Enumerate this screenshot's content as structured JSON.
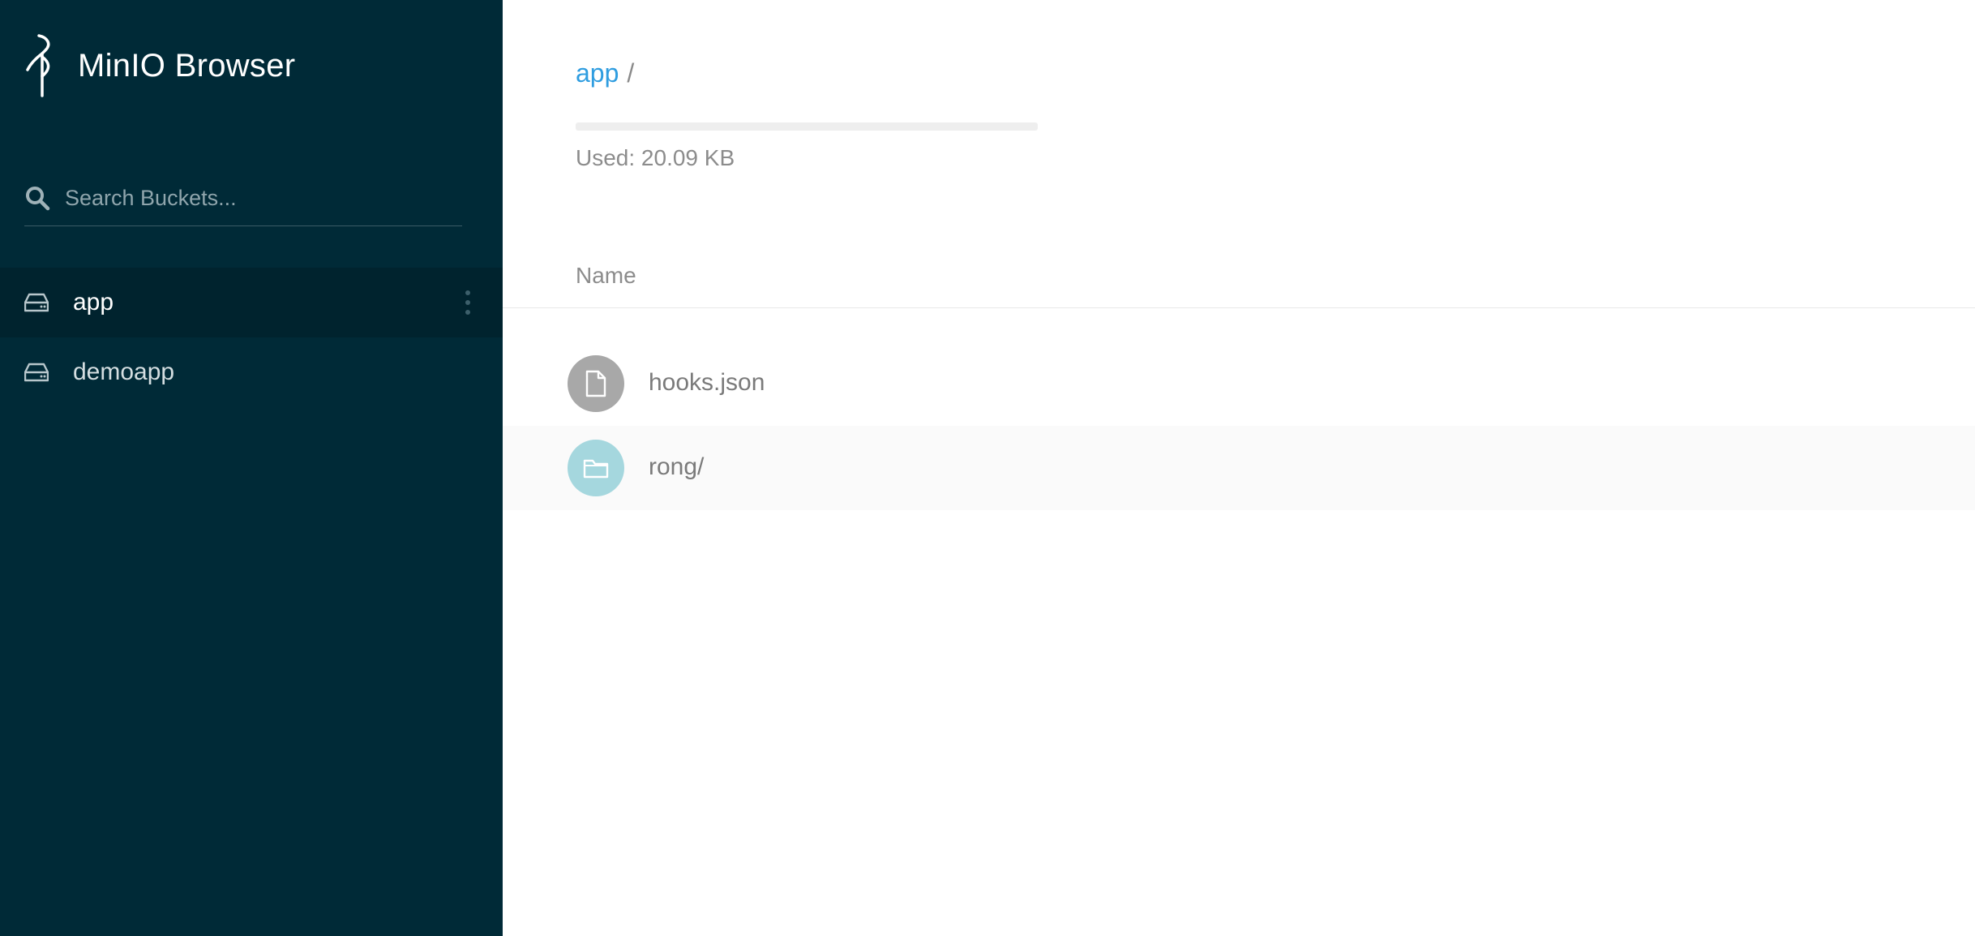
{
  "app": {
    "title": "MinIO Browser"
  },
  "sidebar": {
    "search": {
      "placeholder": "Search Buckets...",
      "value": ""
    },
    "buckets": [
      {
        "label": "app",
        "active": true
      },
      {
        "label": "demoapp",
        "active": false
      }
    ]
  },
  "main": {
    "breadcrumb": {
      "bucket": "app",
      "separator": "/"
    },
    "usage": {
      "text": "Used: 20.09 KB",
      "fraction": 0
    },
    "table": {
      "name_header": "Name",
      "rows": [
        {
          "name": "hooks.json",
          "type": "file",
          "icon": "file-icon"
        },
        {
          "name": "rong/",
          "type": "folder",
          "icon": "folder-icon"
        }
      ]
    }
  },
  "colors": {
    "sidebar_bg": "#002a37",
    "sidebar_active": "#00232e",
    "link": "#2f9de0",
    "file_icon_bg": "#a8a8a8",
    "folder_icon_bg": "#a5d7de"
  }
}
